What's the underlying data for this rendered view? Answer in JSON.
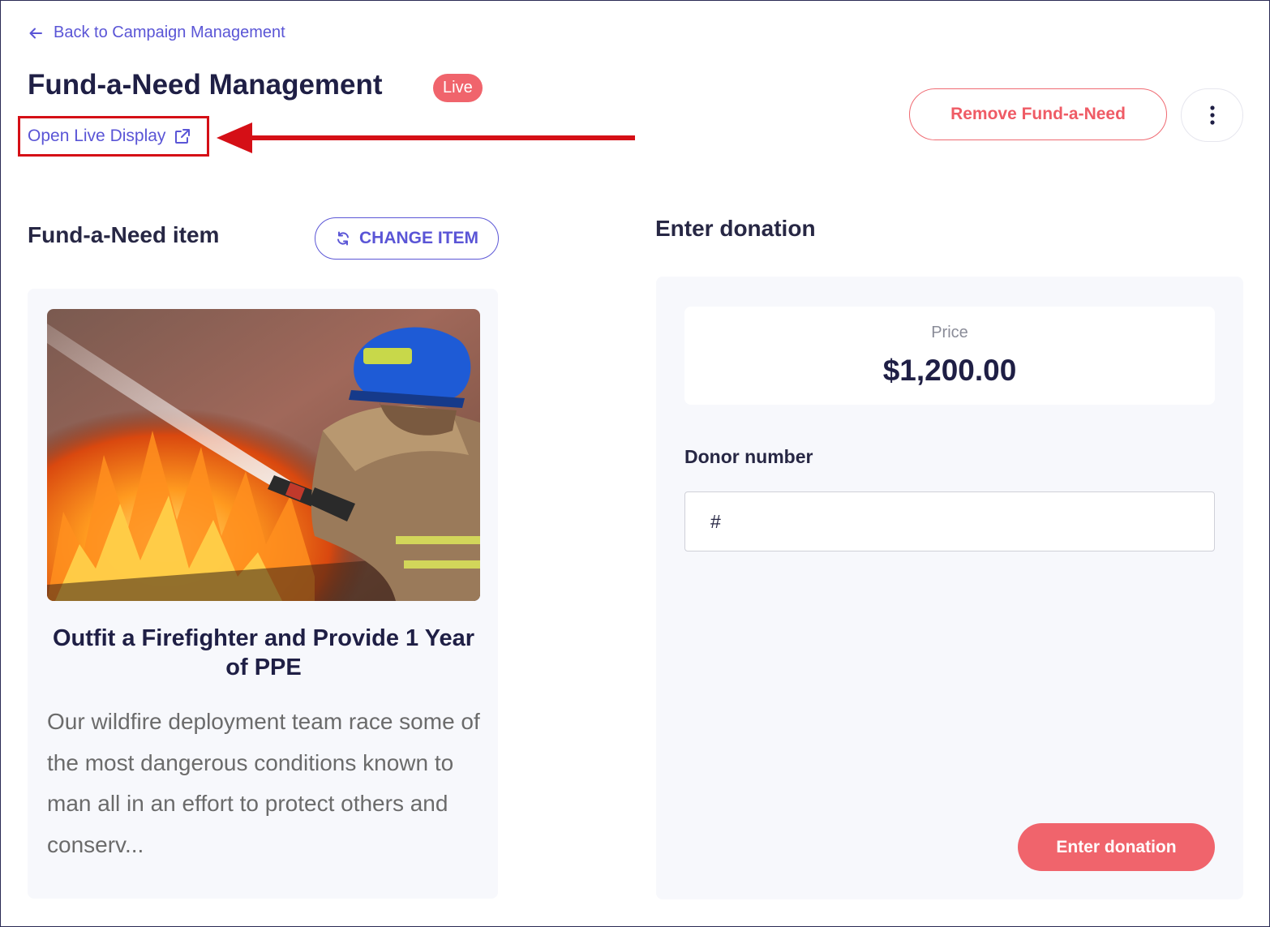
{
  "nav": {
    "back_label": "Back to Campaign Management"
  },
  "header": {
    "title": "Fund-a-Need Management",
    "status_badge": "Live",
    "live_display_label": "Open Live Display",
    "remove_label": "Remove Fund-a-Need"
  },
  "item_section": {
    "title": "Fund-a-Need item",
    "change_label": "CHANGE ITEM",
    "item": {
      "title": "Outfit a Firefighter and Provide 1 Year of PPE",
      "description": "Our wildfire deployment team race some of the most dangerous conditions known to man all in an effort to protect others and conserv..."
    }
  },
  "donation_section": {
    "title": "Enter donation",
    "price_label": "Price",
    "price_value": "$1,200.00",
    "donor_label": "Donor number",
    "donor_placeholder": "#",
    "submit_label": "Enter donation"
  },
  "colors": {
    "accent": "#5a55d6",
    "danger": "#f0646c",
    "annotation": "#d50f16",
    "panel_bg": "#f7f8fc",
    "text_dark": "#1f1f45"
  },
  "icons": [
    "arrow-left-icon",
    "external-link-icon",
    "refresh-icon",
    "more-vertical-icon",
    "annotation-arrow"
  ]
}
